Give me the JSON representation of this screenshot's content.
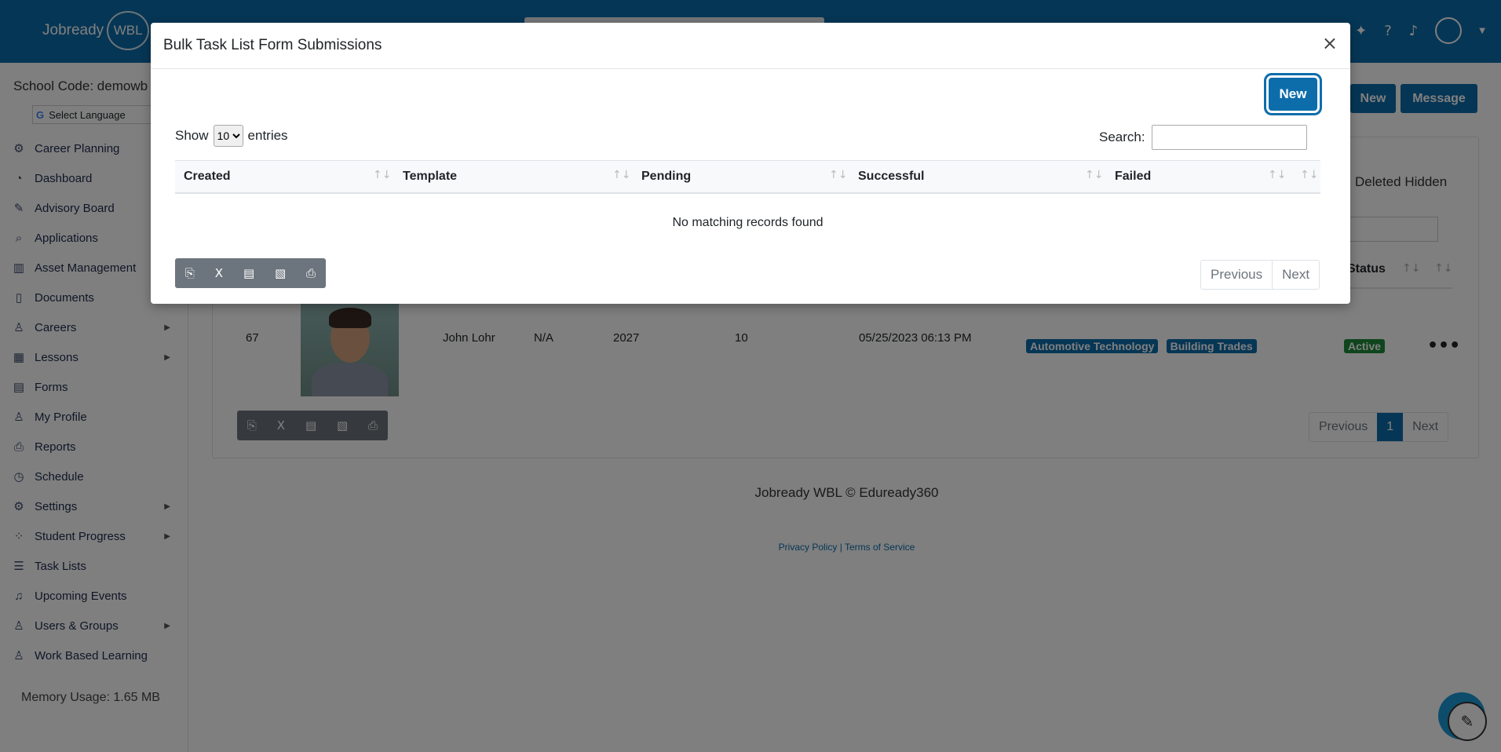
{
  "header": {
    "logo_text": "Jobready",
    "logo_badge": "WBL",
    "icons": [
      "lightbulb-icon",
      "help-icon",
      "bell-icon",
      "user-avatar-icon"
    ]
  },
  "sidebar": {
    "school_code": "School Code: demowb",
    "language_label": "Select Language",
    "items": [
      {
        "label": "Career Planning",
        "icon": "career-planning-icon"
      },
      {
        "label": "Dashboard",
        "icon": "dashboard-icon"
      },
      {
        "label": "Advisory Board",
        "icon": "advisory-board-icon"
      },
      {
        "label": "Applications",
        "icon": "applications-icon"
      },
      {
        "label": "Asset Management",
        "icon": "asset-management-icon"
      },
      {
        "label": "Documents",
        "icon": "documents-icon"
      },
      {
        "label": "Careers",
        "icon": "careers-icon",
        "has_submenu": true
      },
      {
        "label": "Lessons",
        "icon": "lessons-icon",
        "has_submenu": true
      },
      {
        "label": "Forms",
        "icon": "forms-icon"
      },
      {
        "label": "My Profile",
        "icon": "profile-icon"
      },
      {
        "label": "Reports",
        "icon": "reports-icon"
      },
      {
        "label": "Schedule",
        "icon": "schedule-icon"
      },
      {
        "label": "Settings",
        "icon": "settings-icon",
        "has_submenu": true
      },
      {
        "label": "Student Progress",
        "icon": "student-progress-icon",
        "has_submenu": true
      },
      {
        "label": "Task Lists",
        "icon": "task-lists-icon"
      },
      {
        "label": "Upcoming Events",
        "icon": "upcoming-events-icon"
      },
      {
        "label": "Users & Groups",
        "icon": "users-groups-icon",
        "has_submenu": true
      },
      {
        "label": "Work Based Learning",
        "icon": "work-based-learning-icon"
      }
    ],
    "memory_usage": "Memory Usage: 1.65 MB"
  },
  "main": {
    "new_label": "New",
    "message_label": "Message",
    "deleted_hidden_label": "Deleted Hidden",
    "status_header": "Status",
    "row": {
      "id": "67",
      "name": "John Lohr",
      "col3": "N/A",
      "year": "2027",
      "count": "10",
      "date": "05/25/2023 06:13 PM",
      "tags": [
        "Automotive Technology",
        "Building Trades"
      ],
      "status": "Active"
    },
    "pager": {
      "previous": "Previous",
      "current": "1",
      "next": "Next"
    }
  },
  "footer": {
    "text": "Jobready WBL © Eduready360",
    "privacy": "Privacy Policy",
    "separator": "|",
    "terms": "Terms of Service"
  },
  "modal": {
    "title": "Bulk Task List Form Submissions",
    "close_label": "×",
    "new_label": "New",
    "show_label": "Show",
    "entries_label": "entries",
    "page_size": "10",
    "page_size_options": [
      "10"
    ],
    "search_label": "Search:",
    "search_value": "",
    "columns": [
      "Created",
      "Template",
      "Pending",
      "Successful",
      "Failed"
    ],
    "empty_message": "No matching records found",
    "export_tools": [
      "copy-icon",
      "excel-icon",
      "csv-icon",
      "pdf-icon",
      "print-icon"
    ],
    "pager": {
      "previous": "Previous",
      "next": "Next"
    }
  }
}
